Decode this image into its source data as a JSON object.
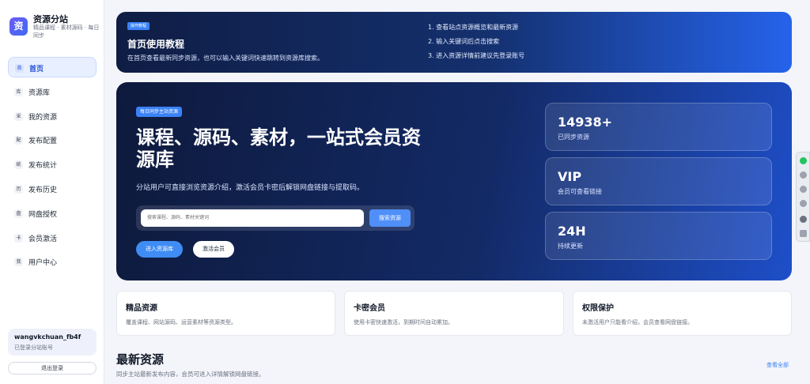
{
  "brand": {
    "logo": "资",
    "title": "资源分站",
    "subtitle": "精品课程 · 素材源码 · 每日同步"
  },
  "nav": [
    {
      "badge": "首",
      "label": "首页",
      "active": true
    },
    {
      "badge": "库",
      "label": "资源库"
    },
    {
      "badge": "采",
      "label": "我的资源"
    },
    {
      "badge": "配",
      "label": "发布配置"
    },
    {
      "badge": "统",
      "label": "发布统计"
    },
    {
      "badge": "历",
      "label": "发布历史"
    },
    {
      "badge": "盘",
      "label": "网盘授权"
    },
    {
      "badge": "卡",
      "label": "会员激活"
    },
    {
      "badge": "我",
      "label": "用户中心"
    }
  ],
  "user": {
    "name": "wangvkchuan_fb4f",
    "status": "已登录分站账号",
    "logout": "退出登录"
  },
  "tutorial": {
    "tag": "操作教程",
    "title": "首页使用教程",
    "desc": "在首页查看最新同步资源，也可以输入关键词快速跳转到资源库搜索。",
    "steps": [
      "1. 查看站点资源概览和最新资源",
      "2. 输入关键词后点击搜索",
      "3. 进入资源详情前建议先登录账号"
    ]
  },
  "hero": {
    "tag": "每日同步主站资源",
    "title": "课程、源码、素材，一站式会员资源库",
    "desc": "分站用户可直接浏览资源介绍，激活会员卡密后解锁网盘链接与提取码。",
    "search_placeholder": "搜索课程、源码、素材关键词",
    "search_button": "搜索资源",
    "enter_button": "进入资源库",
    "activate_button": "激活会员"
  },
  "stats": [
    {
      "value": "14938+",
      "label": "已同步资源"
    },
    {
      "value": "VIP",
      "label": "会员可查看链接"
    },
    {
      "value": "24H",
      "label": "持续更新"
    }
  ],
  "features": [
    {
      "title": "精品资源",
      "desc": "覆盖课程、网站源码、运营素材等资源类型。"
    },
    {
      "title": "卡密会员",
      "desc": "使用卡密快速激活，到期时间自动累加。"
    },
    {
      "title": "权限保护",
      "desc": "未激活用户只能看介绍，会员查看网盘链接。"
    }
  ],
  "latest": {
    "title": "最新资源",
    "desc": "同步主站最新发布内容，会员可进入详情解锁网盘链接。",
    "view_all": "查看全部"
  },
  "colors": {
    "accent": "#3b82f6",
    "hero_dark": "#0e1a3c"
  }
}
